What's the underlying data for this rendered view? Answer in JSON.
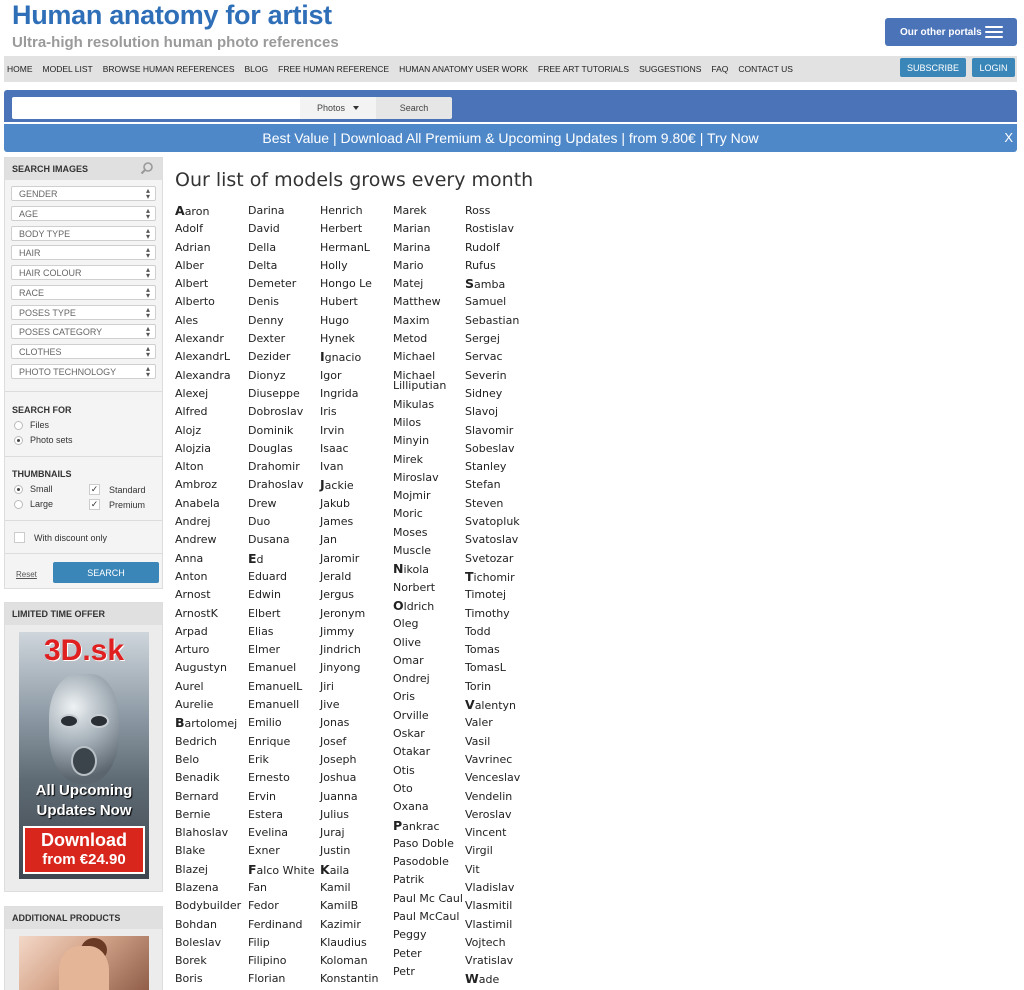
{
  "header": {
    "title": "Human anatomy for artist",
    "subtitle": "Ultra-high resolution human photo references",
    "portals_label": "Our other portals"
  },
  "nav": {
    "items": [
      "HOME",
      "MODEL LIST",
      "BROWSE HUMAN REFERENCES",
      "BLOG",
      "FREE HUMAN REFERENCE",
      "HUMAN ANATOMY USER WORK",
      "FREE ART TUTORIALS",
      "SUGGESTIONS",
      "FAQ",
      "CONTACT US"
    ],
    "subscribe": "SUBSCRIBE",
    "login": "LOGIN"
  },
  "search": {
    "query": "",
    "type_selected": "Photos",
    "button": "Search"
  },
  "banner": {
    "text": "Best Value | Download All Premium & Upcoming Updates | from 9.80€ | Try Now",
    "close": "X"
  },
  "sidebar": {
    "search_images": "SEARCH IMAGES",
    "filters": [
      "GENDER",
      "AGE",
      "BODY TYPE",
      "HAIR",
      "HAIR COLOUR",
      "RACE",
      "POSES TYPE",
      "POSES CATEGORY",
      "CLOTHES",
      "PHOTO TECHNOLOGY"
    ],
    "search_for_label": "SEARCH FOR",
    "search_for": [
      "Files",
      "Photo sets"
    ],
    "thumbnails_label": "THUMBNAILS",
    "sizes": [
      "Small",
      "Large"
    ],
    "types": [
      "Standard",
      "Premium"
    ],
    "discount": "With discount only",
    "reset": "Reset",
    "search_button": "SEARCH",
    "offer_label": "LIMITED TIME OFFER",
    "offer": {
      "logo": "3D.sk",
      "line1": "All Upcoming",
      "line2": "Updates Now",
      "cta1": "Download",
      "cta2": "from €24.90"
    },
    "products_label": "ADDITIONAL PRODUCTS"
  },
  "main": {
    "title": "Our list of models grows every month",
    "columns": [
      [
        "Aaron",
        "Adolf",
        "Adrian",
        "Alber",
        "Albert",
        "Alberto",
        "Ales",
        "Alexandr",
        "AlexandrL",
        "Alexandra",
        "Alexej",
        "Alfred",
        "Alojz",
        "Alojzia",
        "Alton",
        "Ambroz",
        "Anabela",
        "Andrej",
        "Andrew",
        "Anna",
        "Anton",
        "Arnost",
        "ArnostK",
        "Arpad",
        "Arturo",
        "Augustyn",
        "Aurel",
        "Aurelie",
        "Bartolomej",
        "Bedrich",
        "Belo",
        "Benadik",
        "Bernard",
        "Bernie",
        "Blahoslav",
        "Blake",
        "Blazej",
        "Blazena",
        "Bodybuilder",
        "Bohdan",
        "Boleslav",
        "Borek",
        "Boris"
      ],
      [
        "Darina",
        "David",
        "Della",
        "Delta",
        "Demeter",
        "Denis",
        "Denny",
        "Dexter",
        "Dezider",
        "Dionyz",
        "Diuseppe",
        "Dobroslav",
        "Dominik",
        "Douglas",
        "Drahomir",
        "Drahoslav",
        "Drew",
        "Duo",
        "Dusana",
        "Ed",
        "Eduard",
        "Edwin",
        "Elbert",
        "Elias",
        "Elmer",
        "Emanuel",
        "EmanuelL",
        "Emanuell",
        "Emilio",
        "Enrique",
        "Erik",
        "Ernesto",
        "Ervin",
        "Estera",
        "Evelina",
        "Exner",
        "Falco White",
        "Fan",
        "Fedor",
        "Ferdinand",
        "Filip",
        "Filipino",
        "Florian"
      ],
      [
        "Henrich",
        "Herbert",
        "HermanL",
        "Holly",
        "Hongo Le",
        "Hubert",
        "Hugo",
        "Hynek",
        "Ignacio",
        "Igor",
        "Ingrida",
        "Iris",
        "Irvin",
        "Isaac",
        "Ivan",
        "Jackie",
        "Jakub",
        "James",
        "Jan",
        "Jaromir",
        "Jerald",
        "Jergus",
        "Jeronym",
        "Jimmy",
        "Jindrich",
        "Jinyong",
        "Jiri",
        "Jive",
        "Jonas",
        "Josef",
        "Joseph",
        "Joshua",
        "Juanna",
        "Julius",
        "Juraj",
        "Justin",
        "Kaila",
        "Kamil",
        "KamilB",
        "Kazimir",
        "Klaudius",
        "Koloman",
        "Konstantin"
      ],
      [
        "Marek",
        "Marian",
        "Marina",
        "Mario",
        "Matej",
        "Matthew",
        "Maxim",
        "Metod",
        "Michael",
        "Michael Lilliputian",
        "Mikulas",
        "Milos",
        "Minyin",
        "Mirek",
        "Miroslav",
        "Mojmir",
        "Moric",
        "Moses",
        "Muscle",
        "Nikola",
        "Norbert",
        "Oldrich",
        "Oleg",
        "Olive",
        "Omar",
        "Ondrej",
        "Oris",
        "Orville",
        "Oskar",
        "Otakar",
        "Otis",
        "Oto",
        "Oxana",
        "Pankrac",
        "Paso Doble",
        "Pasodoble",
        "Patrik",
        "Paul Mc Caul",
        "Paul McCaul",
        "Peggy",
        "Peter",
        "Petr"
      ],
      [
        "Ross",
        "Rostislav",
        "Rudolf",
        "Rufus",
        "Samba",
        "Samuel",
        "Sebastian",
        "Sergej",
        "Servac",
        "Severin",
        "Sidney",
        "Slavoj",
        "Slavomir",
        "Sobeslav",
        "Stanley",
        "Stefan",
        "Steven",
        "Svatopluk",
        "Svatoslav",
        "Svetozar",
        "Tichomir",
        "Timotej",
        "Timothy",
        "Todd",
        "Tomas",
        "TomasL",
        "Torin",
        "Valentyn",
        "Valer",
        "Vasil",
        "Vavrinec",
        "Venceslav",
        "Vendelin",
        "Veroslav",
        "Vincent",
        "Virgil",
        "Vit",
        "Vladislav",
        "Vlasmitil",
        "Vlastimil",
        "Vojtech",
        "Vratislav",
        "Wade"
      ]
    ],
    "letter_starts": [
      "Aaron",
      "Bartolomej",
      "Ed",
      "Falco White",
      "Ignacio",
      "Jackie",
      "Kaila",
      "Nikola",
      "Oldrich",
      "Pankrac",
      "Samba",
      "Tichomir",
      "Valentyn",
      "Wade"
    ]
  }
}
